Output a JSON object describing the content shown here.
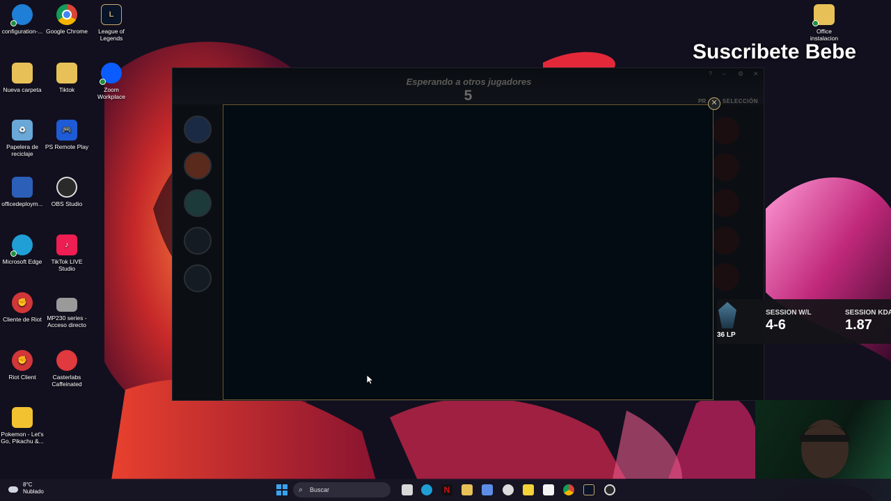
{
  "desktop": {
    "icons": [
      {
        "label": "configuration-...",
        "icon": "edge-file-icon",
        "color": "#1f7fd6"
      },
      {
        "label": "Google Chrome",
        "icon": "chrome-icon",
        "color": "#db4437"
      },
      {
        "label": "League of Legends",
        "icon": "league-icon",
        "color": "#0a1428"
      },
      {
        "label": "Nueva carpeta",
        "icon": "folder-icon",
        "color": "#e7c157"
      },
      {
        "label": "Tiktok",
        "icon": "folder-icon",
        "color": "#e7c157"
      },
      {
        "label": "Zoom Workplace",
        "icon": "zoom-icon",
        "color": "#0b5cff"
      },
      {
        "label": "Papelera de reciclaje",
        "icon": "recycle-bin-icon",
        "color": "#6aa8d8"
      },
      {
        "label": "PS Remote Play",
        "icon": "ps-remote-play-icon",
        "color": "#1e5bd6"
      },
      {
        "label": "officedeploym...",
        "icon": "office-deploy-icon",
        "color": "#2b5fb8"
      },
      {
        "label": "OBS Studio",
        "icon": "obs-icon",
        "color": "#2a2a2a"
      },
      {
        "label": "Microsoft Edge",
        "icon": "edge-icon",
        "color": "#1f9fd6"
      },
      {
        "label": "TikTok LIVE Studio",
        "icon": "tiktok-live-icon",
        "color": "#ee1d52"
      },
      {
        "label": "Cliente de Riot",
        "icon": "riot-icon",
        "color": "#d13639"
      },
      {
        "label": "MP230 series - Acceso directo",
        "icon": "printer-icon",
        "color": "#9a9a9a"
      },
      {
        "label": "Riot Client",
        "icon": "riot-icon",
        "color": "#d13639"
      },
      {
        "label": "Casterlabs Caffeinated",
        "icon": "casterlabs-icon",
        "color": "#e0393e"
      },
      {
        "label": "Pokemon - Let's Go, Pikachu &...",
        "icon": "pokemon-icon",
        "color": "#f2c230"
      },
      {
        "label": "Office instalacion",
        "icon": "folder-icon",
        "color": "#e7c157"
      }
    ]
  },
  "client": {
    "status_title": "Esperando a otros jugadores",
    "timer": "5",
    "selection_label": "SELECCIÓN",
    "selection_prefix": "PR"
  },
  "overlay": {
    "subscribe_text": "Suscribete Bebe",
    "session_wl_label": "SESSION W/L",
    "session_wl_value": "4-6",
    "session_kda_label": "SESSION KDA",
    "session_kda_value": "1.87",
    "lp": "36 LP"
  },
  "taskbar": {
    "weather_temp": "8°C",
    "weather_desc": "Nublado",
    "search_placeholder": "Buscar"
  }
}
